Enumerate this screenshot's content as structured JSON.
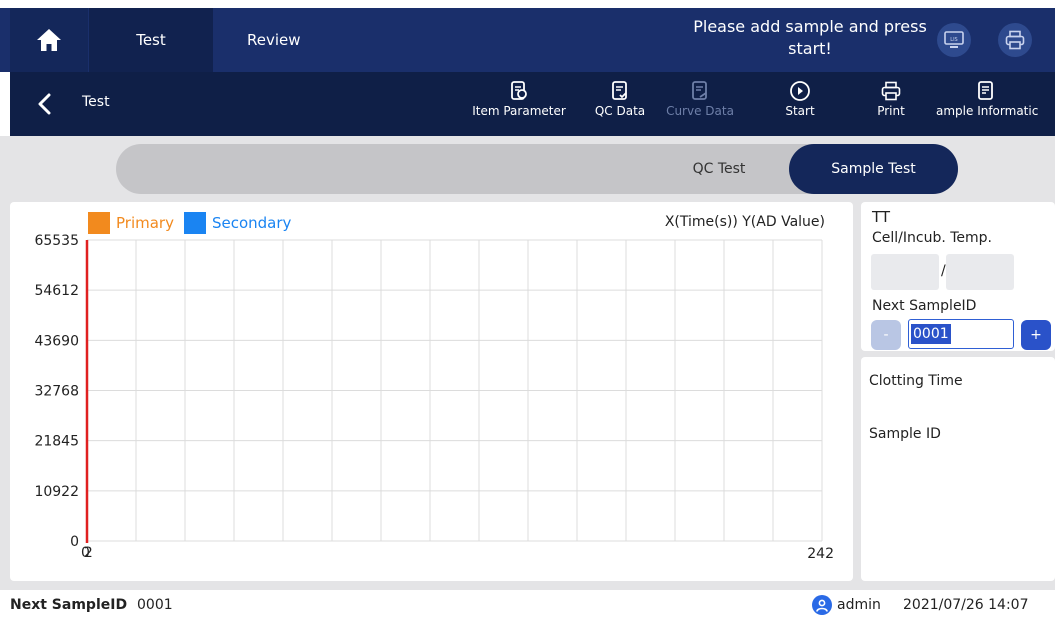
{
  "header": {
    "tabs": [
      {
        "label": "Test",
        "active": true
      },
      {
        "label": "Review",
        "active": false
      }
    ],
    "status_message": "Please add sample and press start!",
    "icons": [
      "home-icon",
      "lis-icon",
      "printer-icon"
    ]
  },
  "toolbar": {
    "title": "Test",
    "tools": [
      {
        "label": "Item Parameter",
        "icon": "item-parameter-icon",
        "enabled": true
      },
      {
        "label": "QC Data",
        "icon": "qc-data-icon",
        "enabled": true
      },
      {
        "label": "Curve Data",
        "icon": "curve-data-icon",
        "enabled": false
      },
      {
        "label": "Start",
        "icon": "start-icon",
        "enabled": true
      },
      {
        "label": "Print",
        "icon": "print-icon",
        "enabled": true
      },
      {
        "label": "ample Informatic",
        "icon": "sample-information-icon",
        "enabled": true
      }
    ]
  },
  "mode_switch": {
    "options": [
      "QC Test",
      "Sample Test"
    ],
    "selected": "Sample Test"
  },
  "chart_data": {
    "type": "line",
    "title": "",
    "series": [
      {
        "name": "Primary",
        "color": "#f28a1e",
        "values": []
      },
      {
        "name": "Secondary",
        "color": "#1a84f2",
        "values": []
      }
    ],
    "axis_note": "X(Time(s))  Y(AD Value)",
    "ylim": [
      0,
      65535
    ],
    "xlim": [
      0,
      242
    ],
    "y_ticks": [
      "65535",
      "54612",
      "43690",
      "32768",
      "21845",
      "10922",
      "0"
    ],
    "x_ticks": [
      "0",
      "2",
      "242"
    ],
    "grid": true,
    "marker_color": "#e02020"
  },
  "side": {
    "item": "TT",
    "temp_label": "Cell/Incub. Temp.",
    "temp_separator": "/",
    "cell_temp": "",
    "incub_temp": "",
    "next_sample_label": "Next SampleID",
    "next_sample_value": "0001",
    "minus_label": "-",
    "plus_label": "+",
    "clotting_time_label": "Clotting Time",
    "sample_id_label": "Sample ID"
  },
  "footer": {
    "next_sample_label": "Next SampleID",
    "next_sample_value": "0001",
    "user": "admin",
    "datetime": "2021/07/26 14:07"
  }
}
